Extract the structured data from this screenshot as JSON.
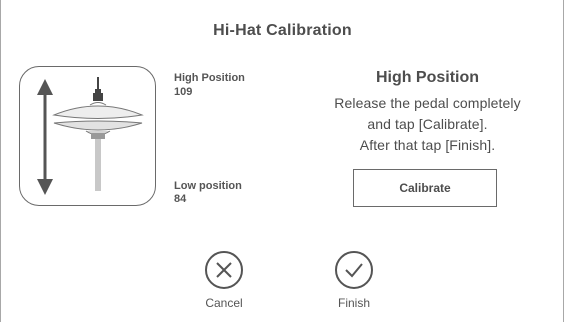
{
  "dialog": {
    "title": "Hi-Hat Calibration"
  },
  "illustration": {
    "icon": "hi-hat-cymbal-with-up-down-arrow"
  },
  "positions": {
    "high": {
      "label": "High Position",
      "value": "109"
    },
    "low": {
      "label": "Low position",
      "value": "84"
    }
  },
  "instructions": {
    "heading": "High Position",
    "line1": "Release the pedal completely",
    "line2": "and tap [Calibrate].",
    "line3": "After that tap [Finish]."
  },
  "buttons": {
    "calibrate": "Calibrate",
    "cancel": {
      "label": "Cancel",
      "icon": "x-circle-icon"
    },
    "finish": {
      "label": "Finish",
      "icon": "check-circle-icon"
    }
  },
  "colors": {
    "text": "#4d4d4d",
    "border": "#6a6a6a",
    "background": "#ffffff"
  }
}
